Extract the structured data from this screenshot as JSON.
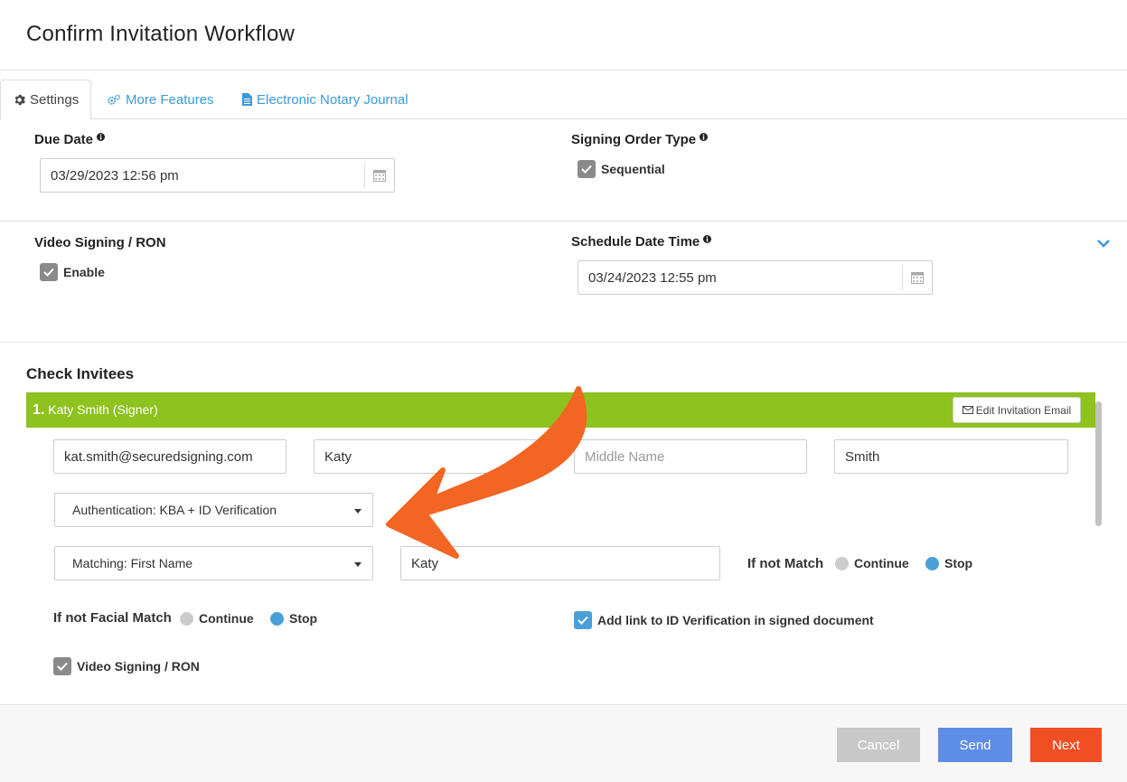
{
  "header": {
    "title": "Confirm Invitation Workflow"
  },
  "tabs": [
    {
      "label": "Settings",
      "icon": "gear-icon",
      "active": true
    },
    {
      "label": "More Features",
      "icon": "gears-icon",
      "active": false
    },
    {
      "label": "Electronic Notary Journal",
      "icon": "document-icon",
      "active": false
    }
  ],
  "settings": {
    "due_date": {
      "label": "Due Date",
      "value": "03/29/2023 12:56 pm"
    },
    "signing_order": {
      "label": "Signing Order Type",
      "checkbox_label": "Sequential",
      "checked": true
    },
    "video_signing": {
      "label": "Video Signing / RON",
      "checkbox_label": "Enable",
      "checked": true
    },
    "schedule": {
      "label": "Schedule Date Time",
      "value": "03/24/2023 12:55 pm"
    }
  },
  "invitees": {
    "heading": "Check Invitees",
    "items": [
      {
        "number": "1.",
        "name": "Katy Smith (Signer)",
        "edit_label": "Edit Invitation Email",
        "email": "kat.smith@securedsigning.com",
        "first_name": "Katy",
        "middle_placeholder": "Middle Name",
        "last_name": "Smith",
        "authentication": "Authentication: KBA + ID Verification",
        "matching": "Matching: First Name",
        "matching_value": "Katy",
        "if_not_match_label": "If not Match",
        "if_not_match_options": [
          "Continue",
          "Stop"
        ],
        "if_not_match_selected": "Stop",
        "facial_match_label": "If not Facial Match",
        "facial_match_options": [
          "Continue",
          "Stop"
        ],
        "facial_match_selected": "Stop",
        "add_link_label": "Add link to ID Verification in signed document",
        "add_link_checked": true,
        "video_signing_label": "Video Signing / RON",
        "video_signing_checked": true
      }
    ]
  },
  "footer": {
    "cancel": "Cancel",
    "send": "Send",
    "next": "Next"
  },
  "colors": {
    "accent_green": "#8dc21f",
    "link_blue": "#3a9ad9",
    "next_orange": "#f04e23",
    "send_blue": "#5d8de6",
    "arrow_orange": "#f26522"
  }
}
